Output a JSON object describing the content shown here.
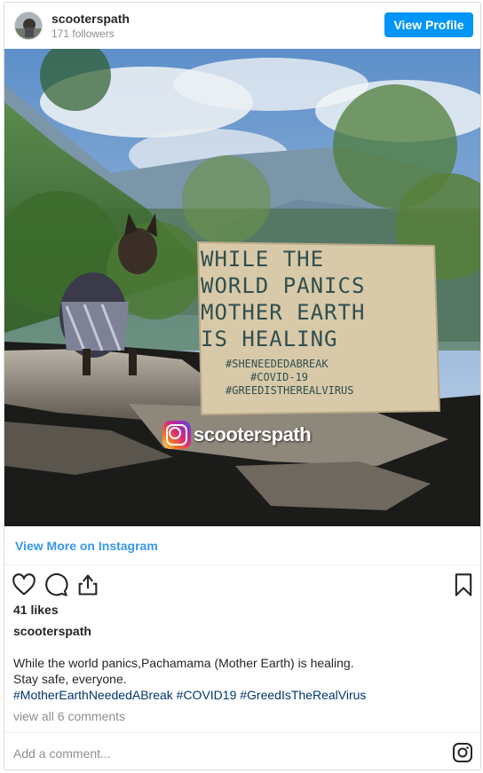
{
  "header": {
    "username": "scooterspath",
    "followers": "171 followers",
    "view_profile": "View Profile"
  },
  "photo": {
    "sign": {
      "line1": "WHILE  THE",
      "line2": "WORLD PANICS",
      "line3": "MOTHER EARTH",
      "line4": "IS  HEALING",
      "tag1": "#SHENEEDEDABREAK",
      "tag2": "#COVID-19",
      "tag3": "#GREEDISTHEREALVIRUS"
    },
    "watermark": "scooterspath"
  },
  "view_more": "View More on Instagram",
  "actions": {
    "like_icon": "heart-icon",
    "comment_icon": "comment-icon",
    "share_icon": "share-icon",
    "save_icon": "bookmark-icon"
  },
  "likes": "41 likes",
  "caption": {
    "username": "scooterspath",
    "line1": "While the world panics,Pachamama (Mother Earth) is healing.",
    "line2": "Stay safe, everyone.",
    "hashtags": "#MotherEarthNeededABreak #COVID19 #GreedIsTheRealVirus"
  },
  "view_comments": "view all 6 comments",
  "comment": {
    "placeholder": "Add a comment..."
  },
  "colors": {
    "accent": "#0095f6",
    "link": "#3897f0",
    "hashtag": "#00376b"
  }
}
